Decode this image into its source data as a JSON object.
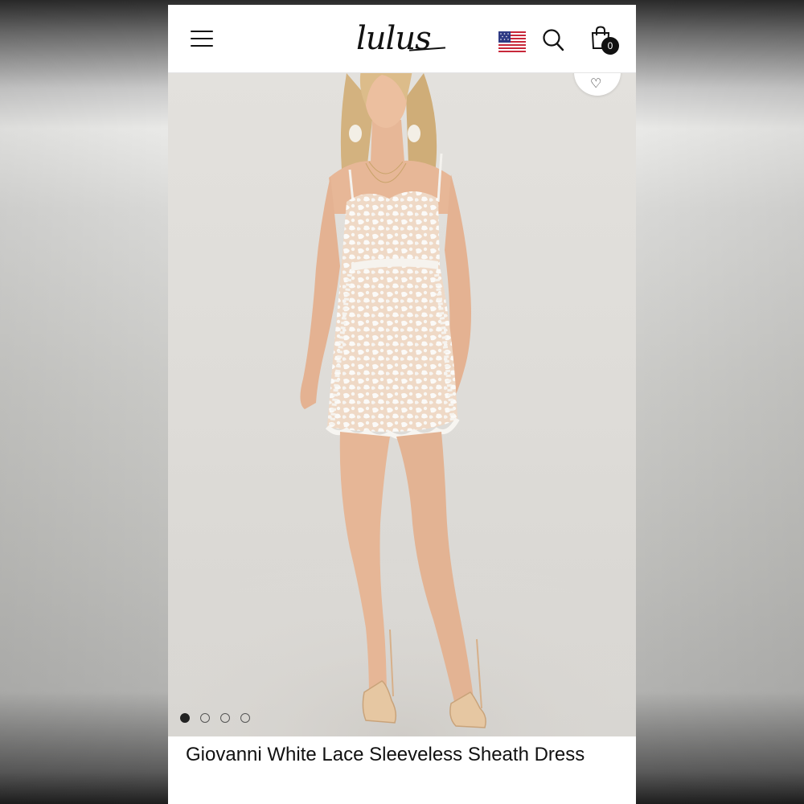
{
  "header": {
    "logo_text": "lulus",
    "cart_count": "0",
    "icons": {
      "menu": "hamburger-menu-icon",
      "flag": "us-flag-icon",
      "search": "search-icon",
      "cart": "shopping-bag-icon"
    }
  },
  "product": {
    "title": "Giovanni White Lace Sleeveless Sheath Dress",
    "image_alt": "Model wearing white lace sheath dress",
    "carousel": {
      "total": 4,
      "active": 1
    },
    "wishlist_icon": "heart-icon"
  },
  "colors": {
    "background": "#ffffff",
    "text": "#111111",
    "photo_bg": "#e0deda",
    "dress": "#f4f2ee",
    "skin": "#e8b99a",
    "hair": "#d9b88a"
  }
}
